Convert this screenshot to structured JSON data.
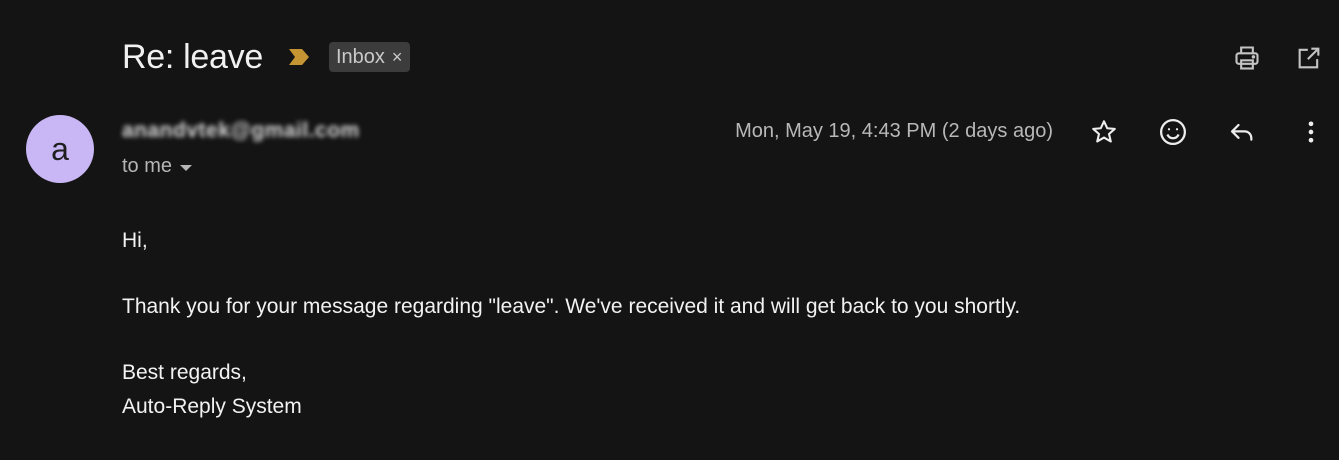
{
  "header": {
    "subject": "Re: leave",
    "label": "Inbox",
    "label_close": "×",
    "important_color": "#c69533"
  },
  "toolbar": {
    "icons": [
      "print-icon",
      "open-in-new-window-icon"
    ]
  },
  "message": {
    "avatar_letter": "a",
    "avatar_color": "#c8b6f5",
    "sender_email": "anandvtek@gmail.com",
    "recipient": "to me",
    "date": "Mon, May 19, 4:43 PM (2 days ago)",
    "actions": [
      "star-icon",
      "emoji-reaction-icon",
      "reply-icon",
      "more-options-icon"
    ]
  },
  "body": {
    "greeting": "Hi,",
    "paragraph": "Thank you for your message regarding \"leave\". We've received it and will get back to you shortly.",
    "closing": "Best regards,",
    "signature": "Auto-Reply System"
  }
}
